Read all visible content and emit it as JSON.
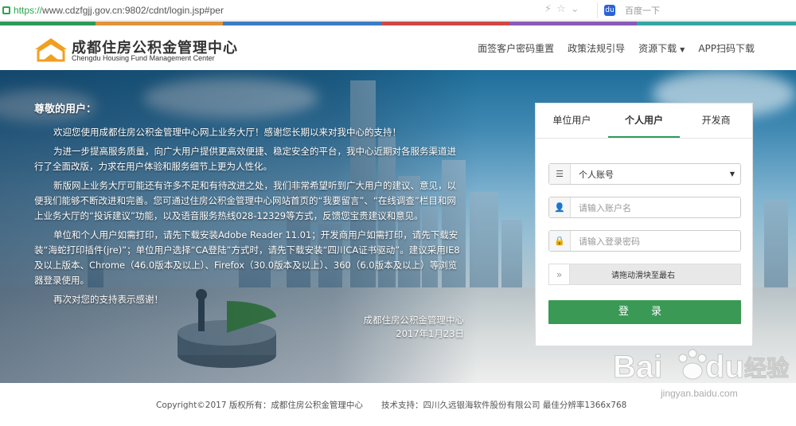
{
  "browser": {
    "url_scheme": "https://",
    "url_rest": "www.cdzfgjj.gov.cn:9802/cdnt/login.jsp#per",
    "search_placeholder": "百度一下"
  },
  "strip_colors": [
    "#2f9a58",
    "#e2923a",
    "#3b7dc4",
    "#d14747",
    "#8a5ab8",
    "#35a7a2"
  ],
  "header": {
    "org_name_cn": "成都住房公积金管理中心",
    "org_name_en": "Chengdu Housing Fund Management Center",
    "nav": [
      "面签客户密码重置",
      "政策法规引导",
      "资源下载",
      "APP扫码下载"
    ]
  },
  "notice": {
    "greeting": "尊敬的用户：",
    "paragraphs": [
      "欢迎您使用成都住房公积金管理中心网上业务大厅！感谢您长期以来对我中心的支持！",
      "为进一步提高服务质量，向广大用户提供更高效便捷、稳定安全的平台，我中心近期对各服务渠道进行了全面改版，力求在用户体验和服务细节上更为人性化。",
      "新版网上业务大厅可能还有许多不足和有待改进之处，我们非常希望听到广大用户的建议、意见，以便我们能够不断改进和完善。您可通过住房公积金管理中心网站首页的“我要留言”、“在线调查”栏目和网上业务大厅的“投诉建议”功能，以及语音服务热线028-12329等方式，反馈您宝贵建议和意见。",
      "单位和个人用户如需打印，请先下载安装Adobe Reader 11.01；开发商用户如需打印，请先下载安装“海蛇打印插件(jre)”；单位用户选择“CA登陆”方式时，请先下载安装“四川CA证书驱动”。建议采用IE8及以上版本、Chrome（46.0版本及以上）、Firefox（30.0版本及以上）、360（6.0版本及以上）等浏览器登录使用。",
      "再次对您的支持表示感谢！"
    ],
    "signature": "成都住房公积金管理中心",
    "date": "2017年1月23日"
  },
  "login": {
    "tabs": [
      "单位用户",
      "个人用户",
      "开发商"
    ],
    "active_tab": "个人用户",
    "account_type_selected": "个人账号",
    "account_placeholder": "请输入账户名",
    "password_placeholder": "请输入登录密码",
    "slider_text": "请拖动滑块至最右",
    "login_button": "登 录",
    "accent_color": "#3a9a55"
  },
  "footer": {
    "copyright": "Copyright©2017 版权所有：成都住房公积金管理中心",
    "tech_support": "技术支持：四川久远银海软件股份有限公司  最佳分辨率1366x768"
  },
  "watermark": {
    "brand": "Bai",
    "brand2": "du",
    "cn": "经验",
    "url": "jingyan.baidu.com"
  }
}
